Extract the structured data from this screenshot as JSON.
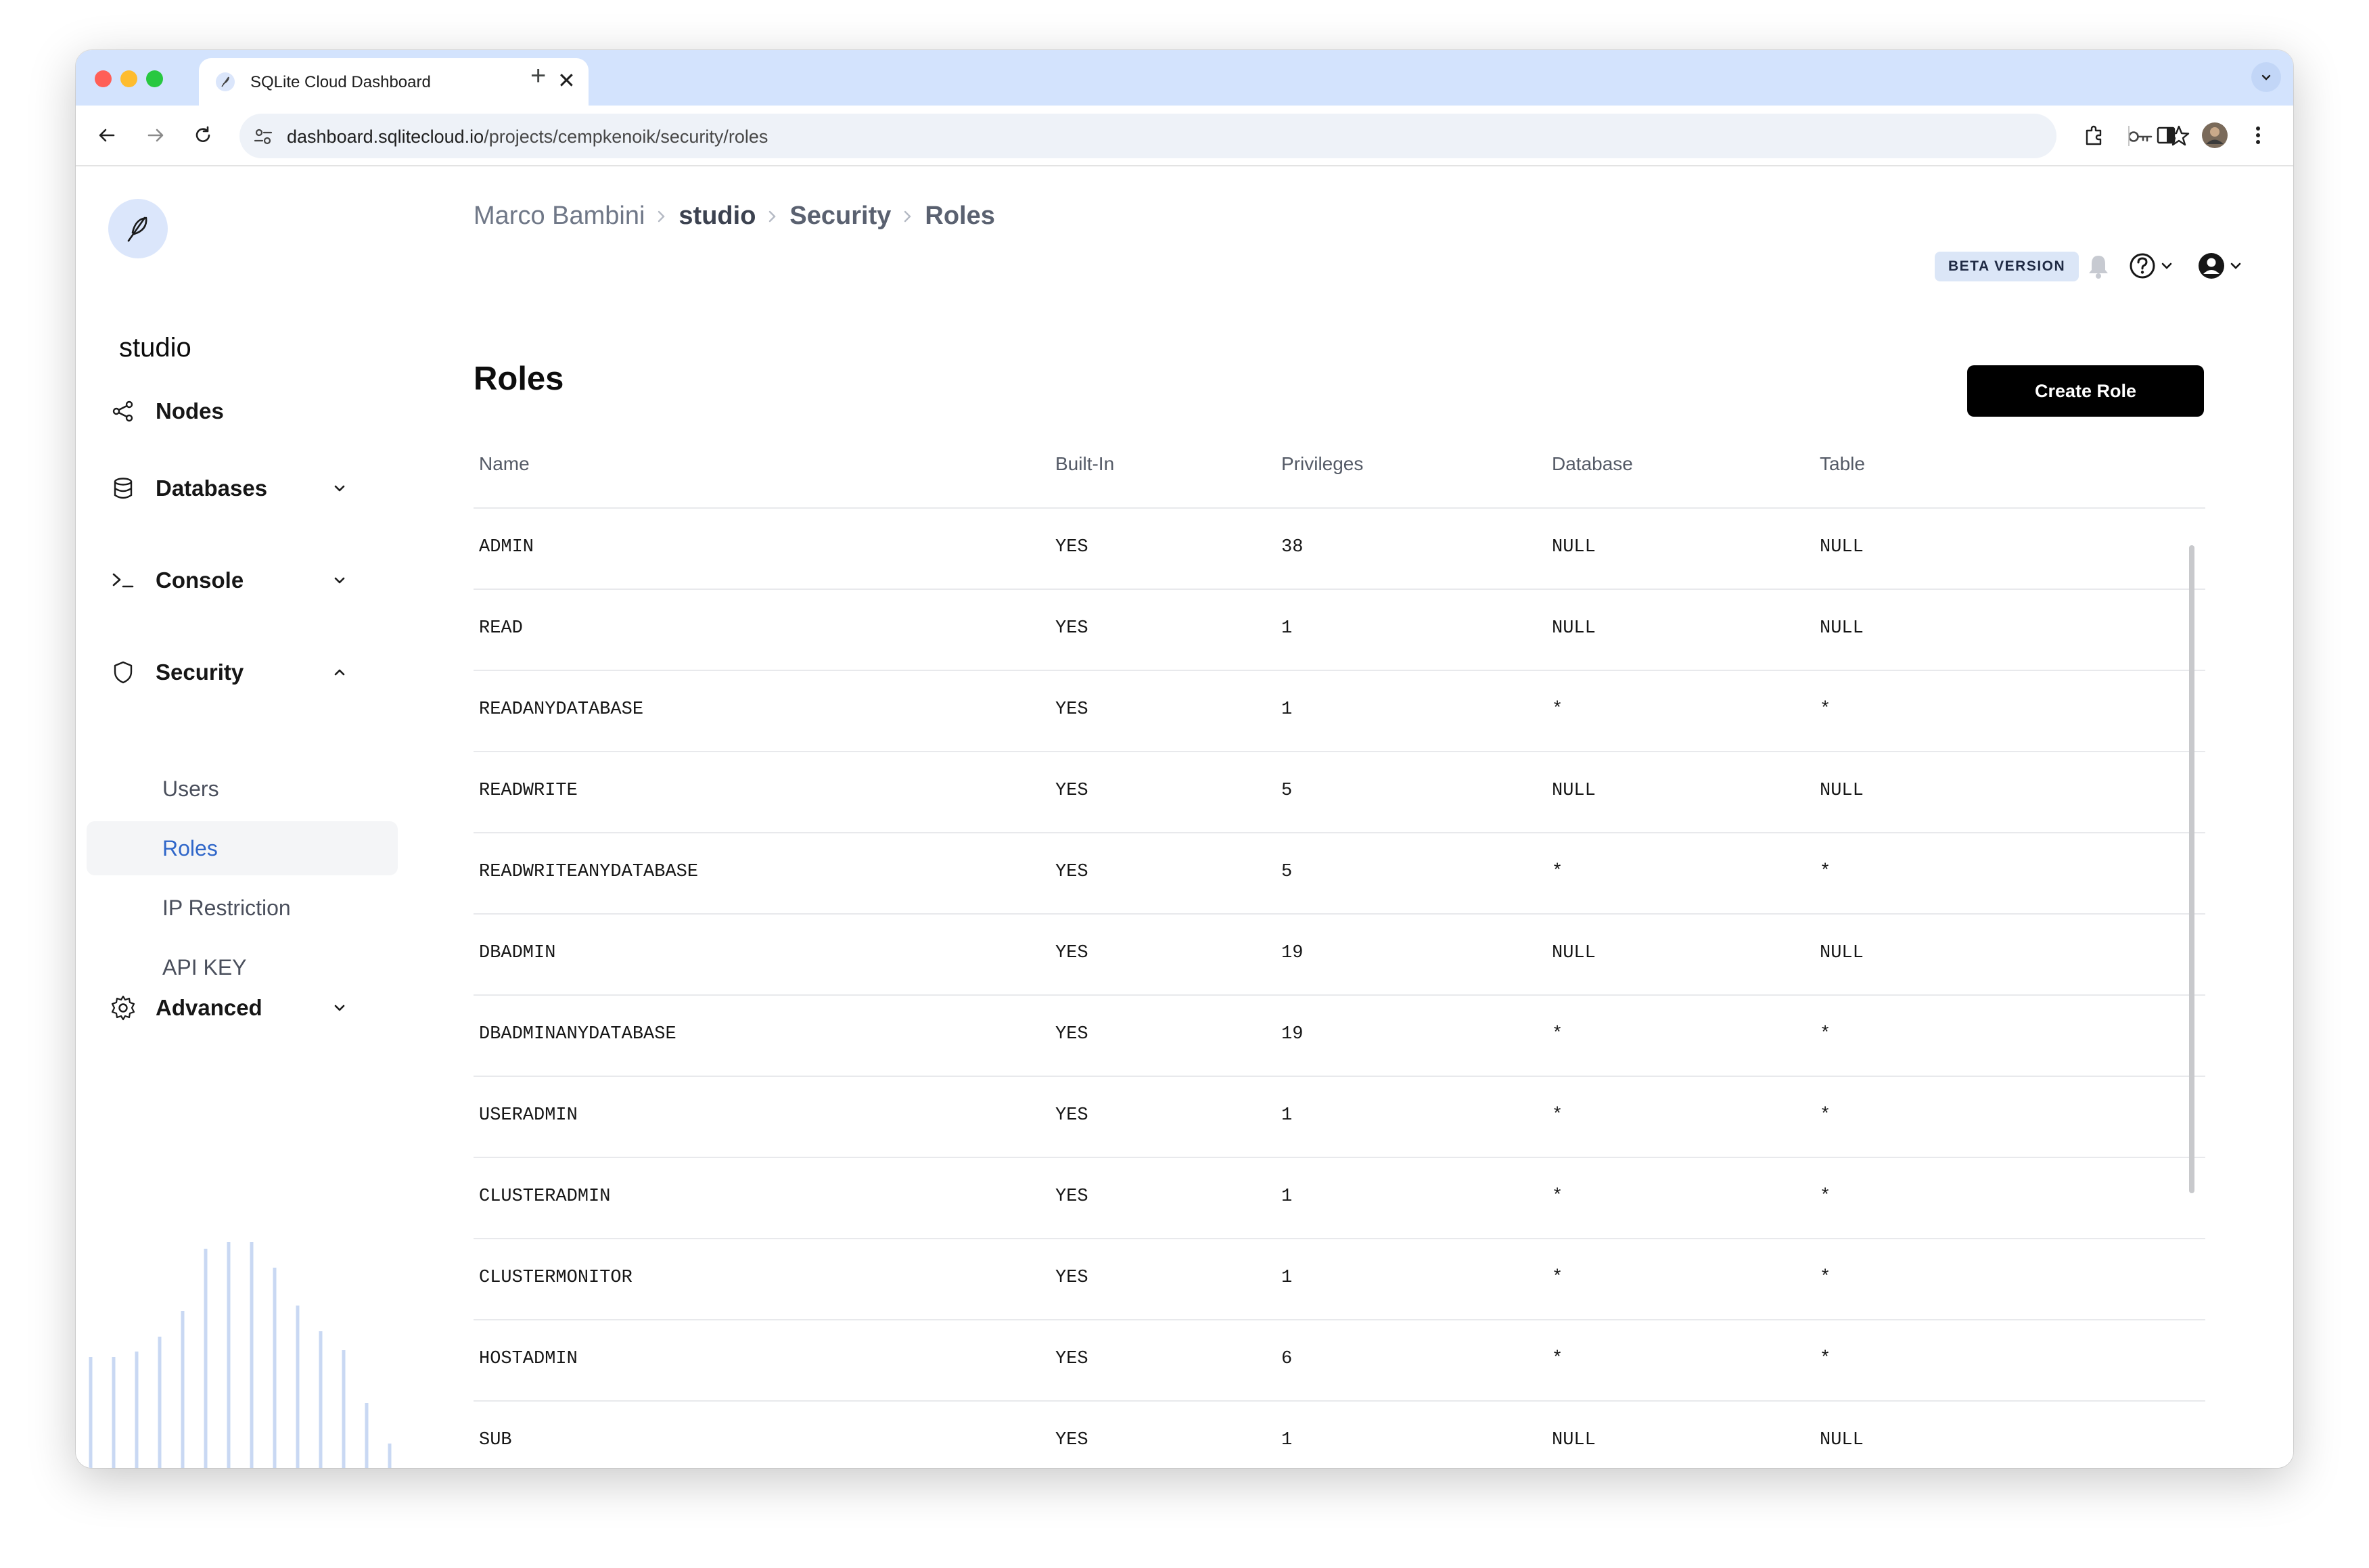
{
  "browser": {
    "tab_title": "SQLite Cloud Dashboard",
    "new_tab_symbol": "+",
    "close_symbol": "✕",
    "url_host": "dashboard.sqlitecloud.io",
    "url_path": "/projects/cempkenoik/security/roles"
  },
  "sidebar": {
    "project_name": "studio",
    "items": [
      {
        "label": "Nodes",
        "icon": "share-nodes-icon"
      },
      {
        "label": "Databases",
        "icon": "database-icon"
      },
      {
        "label": "Console",
        "icon": "terminal-icon"
      },
      {
        "label": "Security",
        "icon": "shield-icon"
      },
      {
        "label": "Advanced",
        "icon": "gear-icon"
      }
    ],
    "security_subitems": [
      "Users",
      "Roles",
      "IP Restriction",
      "API KEY"
    ],
    "active_subitem": "Roles"
  },
  "header": {
    "breadcrumb": [
      "Marco Bambini",
      "studio",
      "Security",
      "Roles"
    ],
    "beta_label": "BETA VERSION"
  },
  "page": {
    "title": "Roles",
    "create_button": "Create Role"
  },
  "table": {
    "columns": [
      "Name",
      "Built-In",
      "Privileges",
      "Database",
      "Table"
    ],
    "rows": [
      [
        "ADMIN",
        "YES",
        "38",
        "NULL",
        "NULL"
      ],
      [
        "READ",
        "YES",
        "1",
        "NULL",
        "NULL"
      ],
      [
        "READANYDATABASE",
        "YES",
        "1",
        "*",
        "*"
      ],
      [
        "READWRITE",
        "YES",
        "5",
        "NULL",
        "NULL"
      ],
      [
        "READWRITEANYDATABASE",
        "YES",
        "5",
        "*",
        "*"
      ],
      [
        "DBADMIN",
        "YES",
        "19",
        "NULL",
        "NULL"
      ],
      [
        "DBADMINANYDATABASE",
        "YES",
        "19",
        "*",
        "*"
      ],
      [
        "USERADMIN",
        "YES",
        "1",
        "*",
        "*"
      ],
      [
        "CLUSTERADMIN",
        "YES",
        "1",
        "*",
        "*"
      ],
      [
        "CLUSTERMONITOR",
        "YES",
        "1",
        "*",
        "*"
      ],
      [
        "HOSTADMIN",
        "YES",
        "6",
        "*",
        "*"
      ],
      [
        "SUB",
        "YES",
        "1",
        "NULL",
        "NULL"
      ]
    ]
  },
  "colors": {
    "accent": "#2f66c9",
    "tabbar": "#d3e3fd",
    "button": "#000000",
    "beta_badge": "#dbe6f7"
  }
}
